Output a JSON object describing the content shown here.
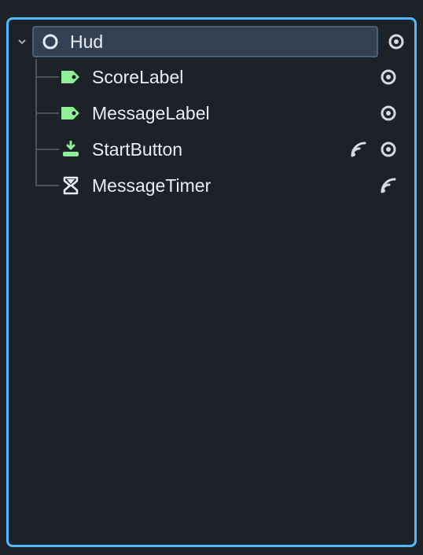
{
  "colors": {
    "panel_border": "#4fb8ff",
    "background": "#1d2229",
    "selected_bg": "#334152",
    "icon_green": "#8eef97",
    "icon_gray": "#d5dae0",
    "text": "#e8eef4"
  },
  "root": {
    "name": "Hud",
    "icon": "canvas-layer-icon",
    "visible": true,
    "expanded": true
  },
  "children": [
    {
      "name": "ScoreLabel",
      "icon": "label-icon",
      "signals": false,
      "visible": true
    },
    {
      "name": "MessageLabel",
      "icon": "label-icon",
      "signals": false,
      "visible": true
    },
    {
      "name": "StartButton",
      "icon": "button-icon",
      "signals": true,
      "visible": true
    },
    {
      "name": "MessageTimer",
      "icon": "timer-icon",
      "signals": true,
      "visible": false
    }
  ]
}
